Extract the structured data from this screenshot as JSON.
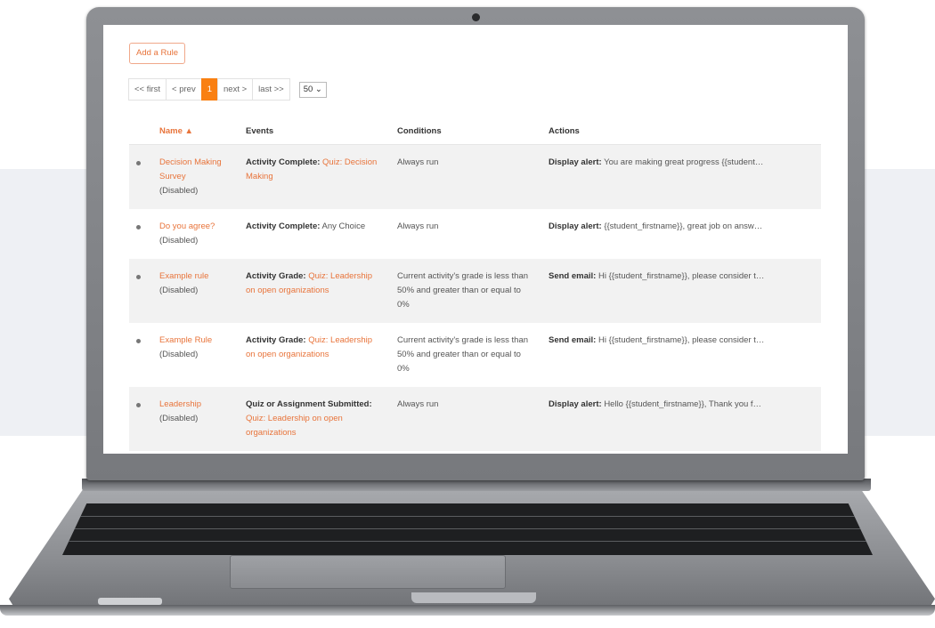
{
  "toolbar": {
    "add_rule_label": "Add a Rule"
  },
  "pager": {
    "first": "<< first",
    "prev": "< prev",
    "current": "1",
    "next": "next >",
    "last": "last >>",
    "per_page": "50"
  },
  "table": {
    "headers": {
      "name": "Name ▲",
      "events": "Events",
      "conditions": "Conditions",
      "actions": "Actions"
    },
    "rows": [
      {
        "name": "Decision Making Survey",
        "status": "(Disabled)",
        "event_label": "Activity Complete:",
        "event_link": "Quiz: Decision Making",
        "event_text": "",
        "condition": "Always run",
        "action_label": "Display alert:",
        "action_text": "You are making great progress {{student…"
      },
      {
        "name": "Do you agree?",
        "status": "(Disabled)",
        "event_label": "Activity Complete:",
        "event_link": "",
        "event_text": "Any Choice",
        "condition": "Always run",
        "action_label": "Display alert:",
        "action_text": "{{student_firstname}}, great job on answ…"
      },
      {
        "name": "Example rule",
        "status": "(Disabled)",
        "event_label": "Activity Grade:",
        "event_link": "Quiz: Leadership on open organizations",
        "event_text": "",
        "condition": "Current activity's grade is less than 50% and greater than or equal to 0%",
        "action_label": "Send email:",
        "action_text": "Hi {{student_firstname}}, please consider t…"
      },
      {
        "name": "Example Rule",
        "status": "(Disabled)",
        "event_label": "Activity Grade:",
        "event_link": "Quiz: Leadership on open organizations",
        "event_text": "",
        "condition": "Current activity's grade is less than 50% and greater than or equal to 0%",
        "action_label": "Send email:",
        "action_text": "Hi {{student_firstname}}, please consider t…"
      },
      {
        "name": "Leadership",
        "status": "(Disabled)",
        "event_label": "Quiz or Assignment Submitted:",
        "event_link": "Quiz: Leadership on open organizations",
        "event_text": "",
        "condition": "Always run",
        "action_label": "Display alert:",
        "action_text": "Hello {{student_firstname}}, Thank you f…"
      }
    ]
  }
}
